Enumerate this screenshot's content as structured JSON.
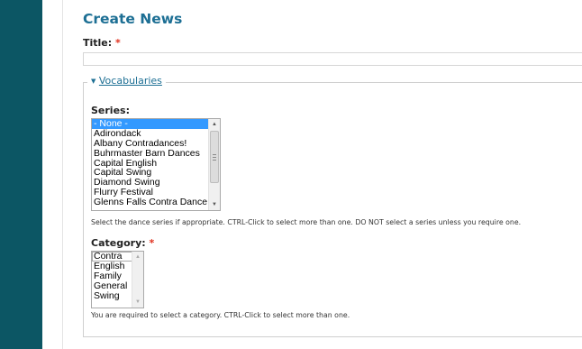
{
  "page": {
    "title": "Create News"
  },
  "title_field": {
    "label": "Title:",
    "required_mark": "*",
    "value": ""
  },
  "vocabularies": {
    "legend_caret": "▼",
    "legend_label": "Vocabularies",
    "series": {
      "label": "Series:",
      "options": [
        "- None -",
        "Adirondack",
        "Albany Contradances!",
        "Buhrmaster Barn Dances",
        "Capital English",
        "Capital Swing",
        "Diamond Swing",
        "Flurry Festival",
        "Glenns Falls Contra Dance"
      ],
      "selected": "- None -",
      "help": "Select the dance series if appropriate. CTRL-Click to select more than one. DO NOT select a series unless you require one."
    },
    "category": {
      "label": "Category:",
      "required_mark": "*",
      "options": [
        "Contra",
        "English",
        "Family",
        "General",
        "Swing"
      ],
      "help": "You are required to select a category. CTRL-Click to select more than one."
    }
  },
  "colors": {
    "sidebar": "#0c5664",
    "title": "#1d6f94",
    "required": "#e0301e",
    "selection": "#3399ff"
  },
  "icons": {
    "scroll_up": "triangle-up-icon",
    "scroll_down": "triangle-down-icon",
    "legend_toggle": "caret-down-icon"
  }
}
